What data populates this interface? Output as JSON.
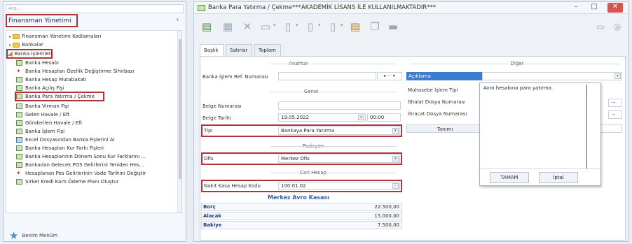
{
  "left_panel": {
    "search_placeholder": "Ara...",
    "section_title": "Finansman Yönetimi",
    "collapse_icon": "chevron-left-icon",
    "tree": [
      {
        "label": "Finansman Yönetimi Kodlamaları",
        "type": "folder",
        "expanded": false
      },
      {
        "label": "Bankalar",
        "type": "folder",
        "expanded": false
      },
      {
        "label": "Banka İşlemleri",
        "type": "folder",
        "expanded": true
      },
      {
        "label": "Banka Hesabı",
        "type": "item"
      },
      {
        "label": "Banka Hesapları Özellik Değiştirme Sihirbazı",
        "type": "wizard"
      },
      {
        "label": "Banka Hesap Mutabakatı",
        "type": "item"
      },
      {
        "label": "Banka Açılış Fişi",
        "type": "item"
      },
      {
        "label": "Banka Para Yatırma / Çekme",
        "type": "item"
      },
      {
        "label": "Banka Virman Fişi",
        "type": "item"
      },
      {
        "label": "Gelen Havale / Eft",
        "type": "item"
      },
      {
        "label": "Gönderilen Havale / Eft",
        "type": "item"
      },
      {
        "label": "Banka İşlem Fişi",
        "type": "item"
      },
      {
        "label": "Excel Dosyasından Banka Fişlerini Al",
        "type": "excel"
      },
      {
        "label": "Banka Hesapları Kur Farkı Fişleri",
        "type": "item"
      },
      {
        "label": "Banka Hesaplarının Dönem Sonu Kur Farklarını ...",
        "type": "item"
      },
      {
        "label": "Bankadan Gelecek POS Gelirlerini Yeniden Hes...",
        "type": "item"
      },
      {
        "label": "Hesaplanan Pos Gelirlerinin Vade Tarihini Değiştir",
        "type": "wizard"
      },
      {
        "label": "Şirket Kredi Kartı Ödeme Planı Oluştur",
        "type": "item"
      }
    ],
    "favorites_label": "Benim Menüm"
  },
  "window": {
    "title": "Banka Para Yatırma / Çekme***AKADEMİK LİSANS İLE KULLANILMAKTADIR***",
    "minimize": "–",
    "maximize": "□",
    "close": "✕",
    "tabs": [
      "Başlık",
      "Satırlar",
      "Toplam"
    ],
    "groups": {
      "anahtar": "Anahtar",
      "genel": "Genel",
      "pozisyon": "Pozisyon",
      "cari": "Cari Hesap",
      "diger": "Diğer"
    },
    "fields": {
      "ref_label": "Banka İşlem Ref. Numarası",
      "ref_value": "",
      "ref_buttons": "▸ ··· ▾",
      "belge_no_label": "Belge Numarası",
      "belge_no_value": "",
      "belge_tarihi_label": "Belge Tarihi",
      "belge_tarihi_value": "19.05.2022",
      "belge_saat_value": "00:00",
      "tipi_label": "Tipi",
      "tipi_value": "Bankaya Para Yatırma",
      "ofis_label": "Ofis",
      "ofis_value": "Merkez Ofis",
      "kasa_label": "Nakit Kasa Hesap Kodu",
      "kasa_value": "100 01 02",
      "kasa_name": "Merkez Avro Kasası",
      "borc_label": "Borç",
      "borc_value": "22.500,00",
      "alacak_label": "Alacak",
      "alacak_value": "15.000,00",
      "bakiye_label": "Bakiye",
      "bakiye_value": "7.500,00"
    },
    "diger": {
      "aciklama_label": "Açıklama",
      "muhasebe_label": "Muhasebe İşlem Tipi",
      "ithalat_label": "İthalat Dosya Numarası",
      "ihracat_label": "İhracat Dosya Numarası",
      "tanimi_header": "Tanımı"
    },
    "popup": {
      "text": "Avro hesabına para yatırma.",
      "ok_label": "TAMAM",
      "cancel_label": "İptal"
    }
  },
  "colors": {
    "highlight": "#b2333b",
    "kasa_name": "#2e5fa8",
    "aciklama_bg": "#3b7bd1"
  }
}
